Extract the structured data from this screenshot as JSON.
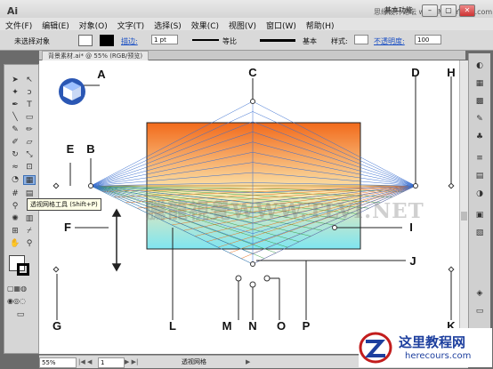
{
  "app": {
    "logo": "Ai",
    "workspace_label": "基本功能",
    "watermark_header": "思缘设计论坛 www.MISSYUAN.com"
  },
  "menus": [
    "文件(F)",
    "编辑(E)",
    "对象(O)",
    "文字(T)",
    "选择(S)",
    "效果(C)",
    "视图(V)",
    "窗口(W)",
    "帮助(H)"
  ],
  "window_buttons": [
    "–",
    "▢",
    "✕"
  ],
  "control": {
    "selection": "未选择对象",
    "stroke_label": "描边:",
    "stroke_weight": "1 pt",
    "profile": "等比",
    "brush": "基本",
    "style_label": "样式:",
    "opacity_label": "不透明度:",
    "opacity_value": "100"
  },
  "document": {
    "tab_title": "背景素材.ai* @ 55% (RGB/预览)"
  },
  "tooltip": "透视网格工具 (Shift+P)",
  "status": {
    "zoom": "55%",
    "page": "1",
    "tool": "透视网格"
  },
  "watermark": "騰龍視覺WWW.TLVI.NET",
  "callouts": [
    "A",
    "B",
    "C",
    "D",
    "E",
    "F",
    "G",
    "H",
    "I",
    "J",
    "K",
    "L",
    "M",
    "N",
    "O",
    "P"
  ],
  "footer_logo": {
    "title": "这里教程网",
    "url": "herecours.com"
  },
  "colors": {
    "grid_left": "#3aa04a",
    "grid_right": "#e87420",
    "grid_vertical": "#3a6fd0",
    "gradient_top": "#f36b1a",
    "gradient_bottom": "#7fe7f0"
  }
}
